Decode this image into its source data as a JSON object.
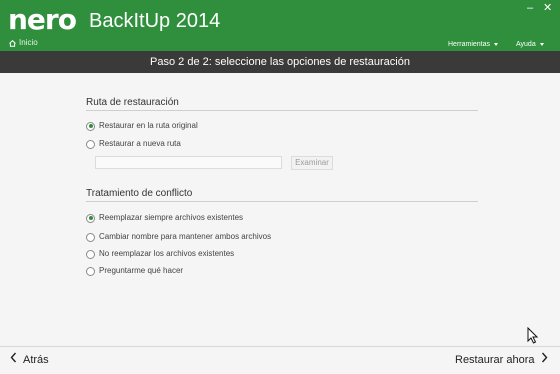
{
  "header": {
    "logo_text": "nero",
    "product_name": "BackItUp 2014",
    "home_label": "Inicio",
    "menu": [
      {
        "label": "Herramientas"
      },
      {
        "label": "Ayuda"
      }
    ],
    "window_controls": {
      "minimize": "–",
      "close": "✕"
    }
  },
  "step_title": "Paso 2 de 2: seleccione las opciones de restauración",
  "restore_path": {
    "heading": "Ruta de restauración",
    "options": [
      {
        "label": "Restaurar en la ruta original",
        "selected": true
      },
      {
        "label": "Restaurar a nueva ruta",
        "selected": false
      }
    ],
    "path_value": "",
    "browse_label": "Examinar"
  },
  "conflict": {
    "heading": "Tratamiento de conflicto",
    "options": [
      {
        "label": "Reemplazar siempre archivos existentes",
        "selected": true
      },
      {
        "label": "Cambiar nombre para mantener ambos archivos",
        "selected": false
      },
      {
        "label": "No reemplazar los archivos existentes",
        "selected": false
      },
      {
        "label": "Preguntarme qué hacer",
        "selected": false
      }
    ]
  },
  "footer": {
    "back_label": "Atrás",
    "next_label": "Restaurar ahora"
  },
  "colors": {
    "header_green": "#2f8f3c",
    "step_bar": "#3a3a3a",
    "background": "#f4f5f4",
    "radio_selected": "#2f8f3c"
  },
  "icons": [
    "home-icon",
    "chevron-left-icon",
    "chevron-right-icon",
    "mouse-cursor-icon"
  ]
}
